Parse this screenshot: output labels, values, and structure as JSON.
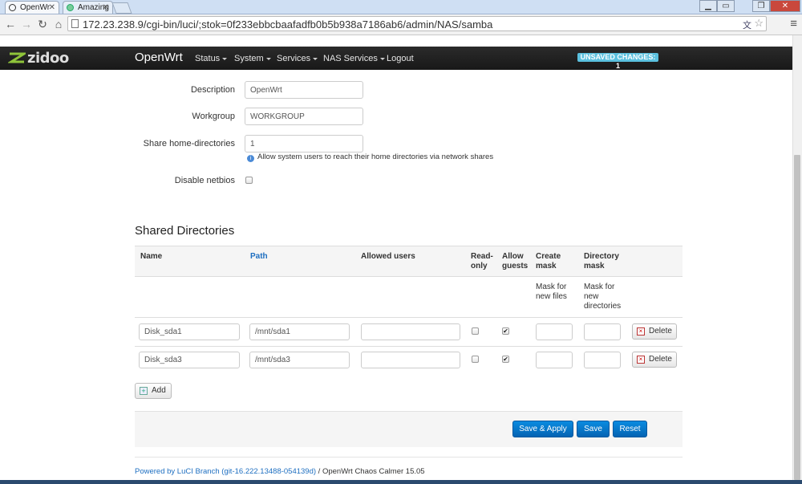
{
  "browser": {
    "tabs": [
      {
        "label": "OpenWr",
        "active": true
      },
      {
        "label": "Amazing",
        "active": false
      }
    ],
    "url": "172.23.238.9/cgi-bin/luci/;stok=0f233ebbcbaafadfb0b5b938a7186ab6/admin/NAS/samba"
  },
  "header": {
    "logo": "zidoo",
    "brand": "OpenWrt",
    "nav": [
      "Status",
      "System",
      "Services",
      "NAS Services",
      "Logout"
    ],
    "unsaved": "UNSAVED CHANGES: 1",
    "accent": "#5bc0de"
  },
  "form": {
    "description_label": "Description",
    "description_value": "OpenWrt",
    "workgroup_label": "Workgroup",
    "workgroup_value": "WORKGROUP",
    "homedirs_label": "Share home-directories",
    "homedirs_value": "1",
    "homedirs_help": "Allow system users to reach their home directories via network shares",
    "netbios_label": "Disable netbios"
  },
  "shares": {
    "title": "Shared Directories",
    "headers": {
      "name": "Name",
      "path": "Path",
      "users": "Allowed users",
      "readonly": "Read-\nonly",
      "guests": "Allow\nguests",
      "create_mask": "Create\nmask",
      "dir_mask": "Directory\nmask"
    },
    "create_mask_desc": "Mask for\nnew files",
    "dir_mask_desc": "Mask for\nnew\ndirectories",
    "rows": [
      {
        "name": "Disk_sda1",
        "path": "/mnt/sda1",
        "users": "",
        "readonly": false,
        "guests": true,
        "create_mask": "",
        "dir_mask": ""
      },
      {
        "name": "Disk_sda3",
        "path": "/mnt/sda3",
        "users": "",
        "readonly": false,
        "guests": true,
        "create_mask": "",
        "dir_mask": ""
      }
    ],
    "delete_label": "Delete",
    "add_label": "Add"
  },
  "actions": {
    "save_apply": "Save & Apply",
    "save": "Save",
    "reset": "Reset",
    "primary_color": "#0a7fd8"
  },
  "footer": {
    "link": "Powered by LuCI Branch (git-16.222.13488-054139d)",
    "text": " / OpenWrt Chaos Calmer 15.05"
  }
}
